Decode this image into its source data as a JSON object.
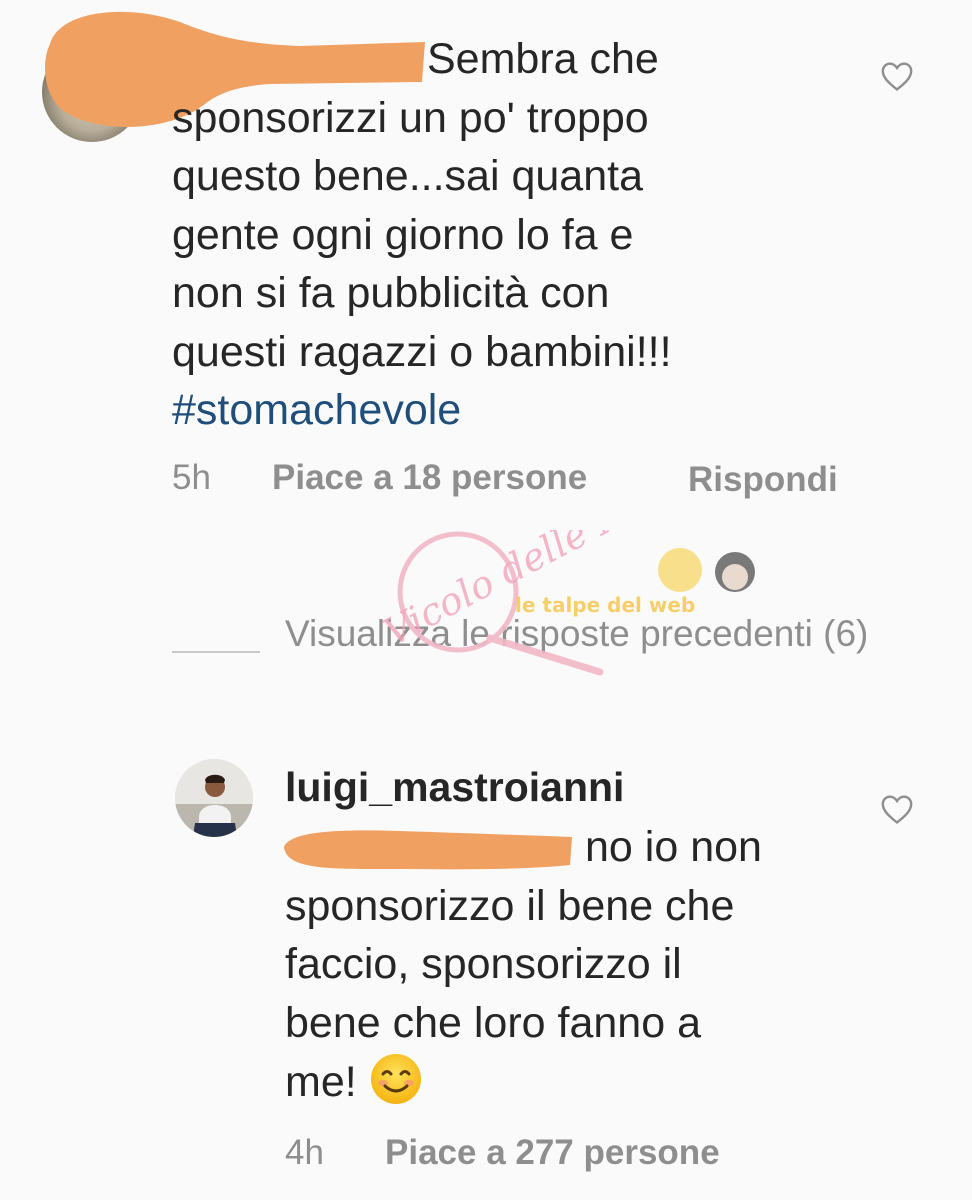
{
  "comments": [
    {
      "text_lines": [
        "Sembra che",
        "sponsorizzi un po' troppo",
        "questo bene...sai quanta",
        "gente ogni giorno lo fa e",
        "non si fa pubblicità con",
        "questi ragazzi o bambini!!!"
      ],
      "hashtag": "#stomachevole",
      "time": "5h",
      "likes": "Piace a 18 persone",
      "reply": "Rispondi"
    },
    {
      "username": "luigi_mastroianni",
      "text_lines": [
        "no io non",
        "sponsorizzo il bene che",
        "faccio, sponsorizzo il",
        "bene che loro fanno a",
        "me!"
      ],
      "emoji": "smiling-face-emoji",
      "time": "4h",
      "likes": "Piace a 277 persone"
    }
  ],
  "thread": {
    "view_replies": "Visualizza le risposte precedenti (6)"
  },
  "watermark": {
    "script_text": "Vicolo delle News",
    "tagline": "le talpe del web"
  },
  "colors": {
    "redaction": "#f0a162",
    "hashtag": "#1f4e7a",
    "meta": "#8e8e8e",
    "text": "#262626"
  },
  "icons": [
    "heart-outline-icon",
    "avatar"
  ]
}
